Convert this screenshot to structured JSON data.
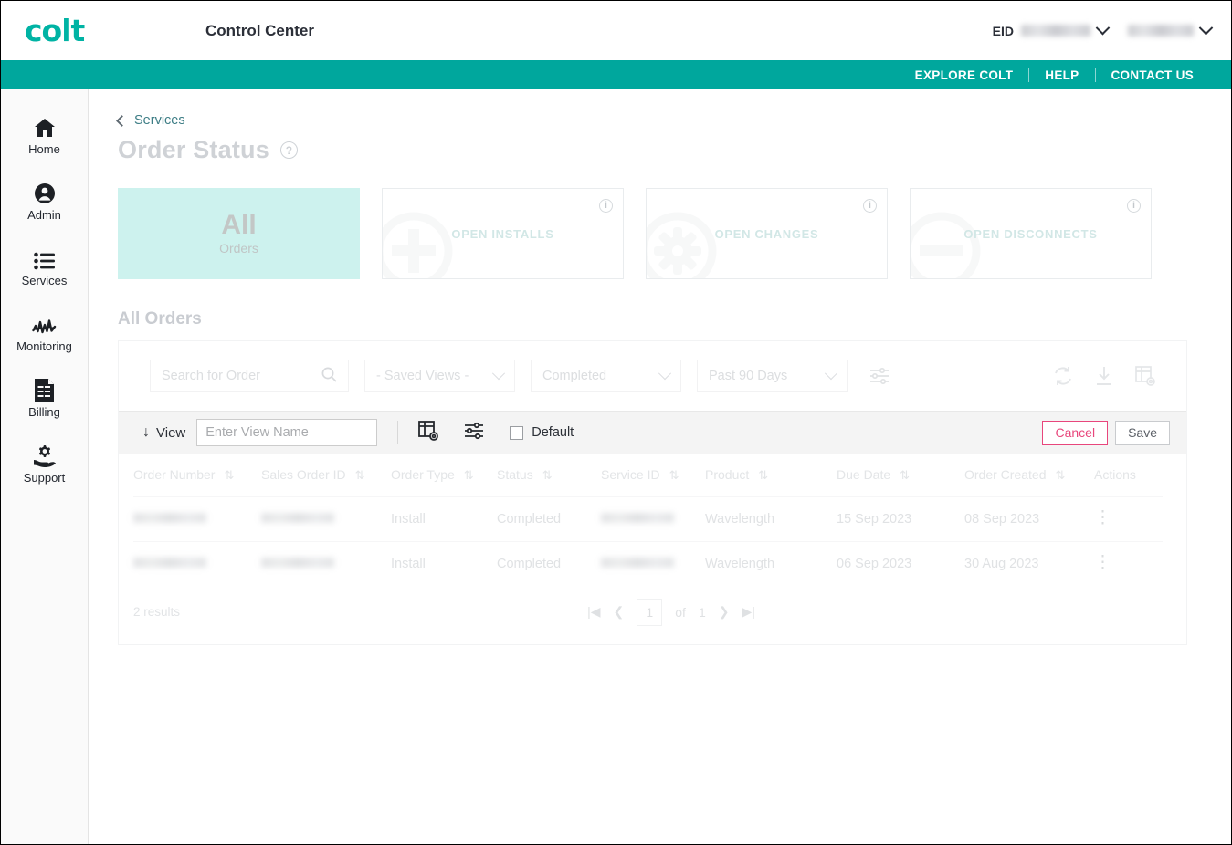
{
  "header": {
    "logo": "colt",
    "app_title": "Control Center",
    "eid_label": "EID",
    "eid_value": "",
    "account_value": ""
  },
  "teal_nav": {
    "items": [
      {
        "label": "EXPLORE COLT"
      },
      {
        "label": "HELP"
      },
      {
        "label": "CONTACT US"
      }
    ]
  },
  "sidebar": {
    "items": [
      {
        "label": "Home",
        "icon": "home-icon"
      },
      {
        "label": "Admin",
        "icon": "user-circle-icon"
      },
      {
        "label": "Services",
        "icon": "list-icon"
      },
      {
        "label": "Monitoring",
        "icon": "activity-icon"
      },
      {
        "label": "Billing",
        "icon": "invoice-icon"
      },
      {
        "label": "Support",
        "icon": "support-gear-icon"
      }
    ]
  },
  "breadcrumb": {
    "label": "Services"
  },
  "page": {
    "title": "Order Status",
    "help": "?"
  },
  "cards": [
    {
      "big": "All",
      "sub": "Orders",
      "selected": true
    },
    {
      "label": "OPEN INSTALLS",
      "icon": "plus-circle-icon",
      "info": "i"
    },
    {
      "label": "OPEN CHANGES",
      "icon": "gear-circle-icon",
      "info": "i"
    },
    {
      "label": "OPEN DISCONNECTS",
      "icon": "minus-circle-icon",
      "info": "i"
    }
  ],
  "section": {
    "title": "All Orders"
  },
  "filters": {
    "search_placeholder": "Search for Order",
    "search_value": "",
    "saved_views": "- Saved Views -",
    "status": "Completed",
    "date_range": "Past 90 Days",
    "icons": {
      "sliders": "sliders-icon",
      "refresh": "refresh-icon",
      "download": "download-icon",
      "table_settings": "table-settings-icon"
    }
  },
  "viewbar": {
    "arrow": "↓",
    "view_label": "View",
    "viewname_placeholder": "Enter View Name",
    "viewname_value": "",
    "default_label": "Default",
    "default_checked": false,
    "cancel_label": "Cancel",
    "save_label": "Save",
    "cancel_color": "#e8467c"
  },
  "table": {
    "columns": [
      {
        "label": "Order Number",
        "sortable": true
      },
      {
        "label": "Sales Order ID",
        "sortable": true
      },
      {
        "label": "Order Type",
        "sortable": true
      },
      {
        "label": "Status",
        "sortable": true
      },
      {
        "label": "Service ID",
        "sortable": true
      },
      {
        "label": "Product",
        "sortable": true
      },
      {
        "label": "Due Date",
        "sortable": true
      },
      {
        "label": "Order Created",
        "sortable": true
      },
      {
        "label": "Actions",
        "sortable": false
      }
    ],
    "rows": [
      {
        "order_number": "",
        "sales_order_id": "",
        "order_type": "Install",
        "status": "Completed",
        "service_id": "",
        "product": "Wavelength",
        "due_date": "15 Sep 2023",
        "order_created": "08 Sep 2023",
        "actions": "⋮"
      },
      {
        "order_number": "",
        "sales_order_id": "",
        "order_type": "Install",
        "status": "Completed",
        "service_id": "",
        "product": "Wavelength",
        "due_date": "06 Sep 2023",
        "order_created": "30 Aug 2023",
        "actions": "⋮"
      }
    ]
  },
  "footer": {
    "results": "2 results",
    "page_value": "1",
    "of_label": "of",
    "total_pages": "1"
  },
  "colors": {
    "teal": "#00a79d",
    "logo_teal": "#00b3a4",
    "card_selected_bg": "#cdf2ee",
    "accent_pink": "#e8467c"
  }
}
